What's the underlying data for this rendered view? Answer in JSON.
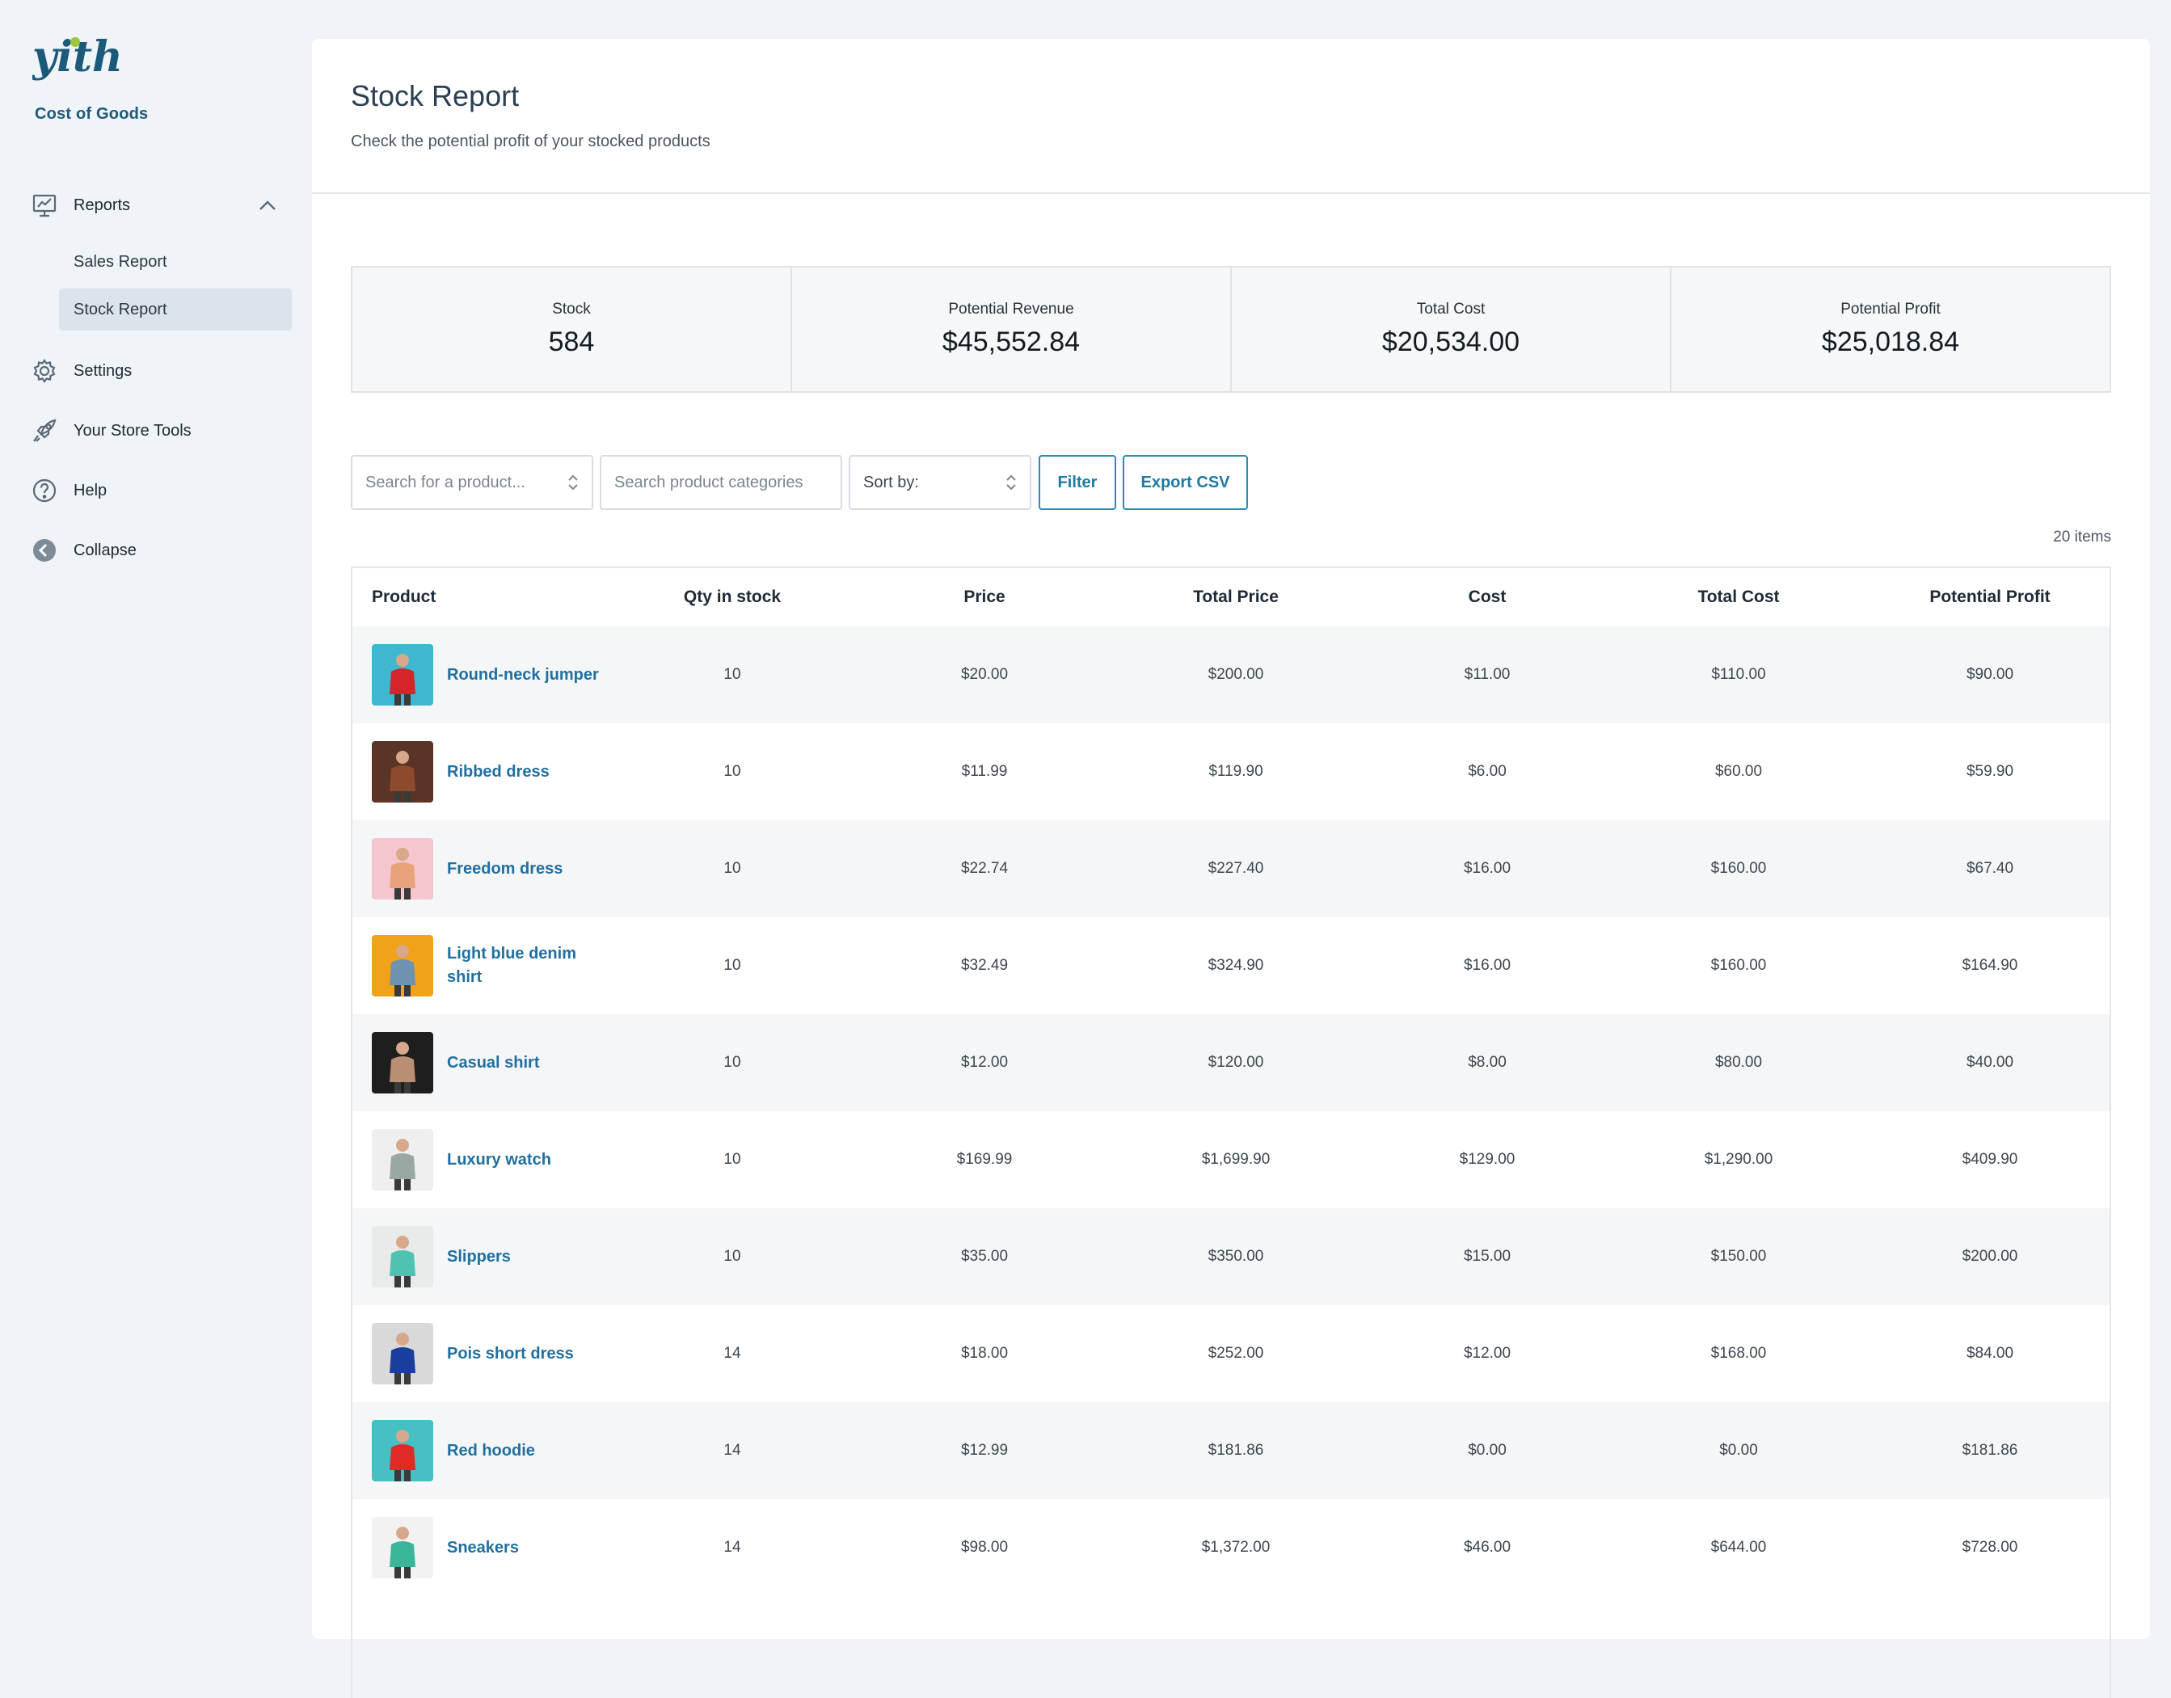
{
  "sidebar": {
    "logo_text": "yith",
    "logo_subtitle": "Cost of Goods",
    "items": [
      {
        "label": "Reports",
        "icon": "chart-icon"
      },
      {
        "label": "Settings",
        "icon": "gear-icon"
      },
      {
        "label": "Your Store Tools",
        "icon": "rocket-icon"
      },
      {
        "label": "Help",
        "icon": "help-icon"
      },
      {
        "label": "Collapse",
        "icon": "collapse-icon"
      }
    ],
    "subitems": [
      {
        "label": "Sales Report"
      },
      {
        "label": "Stock Report"
      }
    ]
  },
  "header": {
    "title": "Stock Report",
    "subtitle": "Check the potential profit of your stocked products"
  },
  "stats": [
    {
      "label": "Stock",
      "value": "584"
    },
    {
      "label": "Potential Revenue",
      "value": "$45,552.84"
    },
    {
      "label": "Total Cost",
      "value": "$20,534.00"
    },
    {
      "label": "Potential Profit",
      "value": "$25,018.84"
    }
  ],
  "filters": {
    "product_placeholder": "Search for a product...",
    "category_placeholder": "Search product categories",
    "sort_label": "Sort by:",
    "filter_button": "Filter",
    "export_button": "Export CSV"
  },
  "items_count": "20 items",
  "table": {
    "columns": [
      "Product",
      "Qty in stock",
      "Price",
      "Total Price",
      "Cost",
      "Total Cost",
      "Potential Profit"
    ],
    "rows": [
      {
        "product": "Round-neck jumper",
        "qty": "10",
        "price": "$20.00",
        "total_price": "$200.00",
        "cost": "$11.00",
        "total_cost": "$110.00",
        "profit": "$90.00",
        "thumb_bg": "#3fb7d0",
        "thumb_fg": "#d5242a"
      },
      {
        "product": "Ribbed dress",
        "qty": "10",
        "price": "$11.99",
        "total_price": "$119.90",
        "cost": "$6.00",
        "total_cost": "$60.00",
        "profit": "$59.90",
        "thumb_bg": "#5a3424",
        "thumb_fg": "#8e4a2e"
      },
      {
        "product": "Freedom dress",
        "qty": "10",
        "price": "$22.74",
        "total_price": "$227.40",
        "cost": "$16.00",
        "total_cost": "$160.00",
        "profit": "$67.40",
        "thumb_bg": "#f6c6cf",
        "thumb_fg": "#e8a37a"
      },
      {
        "product": "Light blue denim shirt",
        "qty": "10",
        "price": "$32.49",
        "total_price": "$324.90",
        "cost": "$16.00",
        "total_cost": "$160.00",
        "profit": "$164.90",
        "thumb_bg": "#f0a21a",
        "thumb_fg": "#6d93b1"
      },
      {
        "product": "Casual shirt",
        "qty": "10",
        "price": "$12.00",
        "total_price": "$120.00",
        "cost": "$8.00",
        "total_cost": "$80.00",
        "profit": "$40.00",
        "thumb_bg": "#1e1e1e",
        "thumb_fg": "#b88f74"
      },
      {
        "product": "Luxury watch",
        "qty": "10",
        "price": "$169.99",
        "total_price": "$1,699.90",
        "cost": "$129.00",
        "total_cost": "$1,290.00",
        "profit": "$409.90",
        "thumb_bg": "#efefef",
        "thumb_fg": "#9aa8a3"
      },
      {
        "product": "Slippers",
        "qty": "10",
        "price": "$35.00",
        "total_price": "$350.00",
        "cost": "$15.00",
        "total_cost": "$150.00",
        "profit": "$200.00",
        "thumb_bg": "#e9eaea",
        "thumb_fg": "#4fc3b1"
      },
      {
        "product": "Pois short dress",
        "qty": "14",
        "price": "$18.00",
        "total_price": "$252.00",
        "cost": "$12.00",
        "total_cost": "$168.00",
        "profit": "$84.00",
        "thumb_bg": "#d9d9d9",
        "thumb_fg": "#1a3e9c"
      },
      {
        "product": "Red hoodie",
        "qty": "14",
        "price": "$12.99",
        "total_price": "$181.86",
        "cost": "$0.00",
        "total_cost": "$0.00",
        "profit": "$181.86",
        "thumb_bg": "#46c0c3",
        "thumb_fg": "#e12a26"
      },
      {
        "product": "Sneakers",
        "qty": "14",
        "price": "$98.00",
        "total_price": "$1,372.00",
        "cost": "$46.00",
        "total_cost": "$644.00",
        "profit": "$728.00",
        "thumb_bg": "#f2f2f2",
        "thumb_fg": "#39b69a"
      }
    ]
  }
}
